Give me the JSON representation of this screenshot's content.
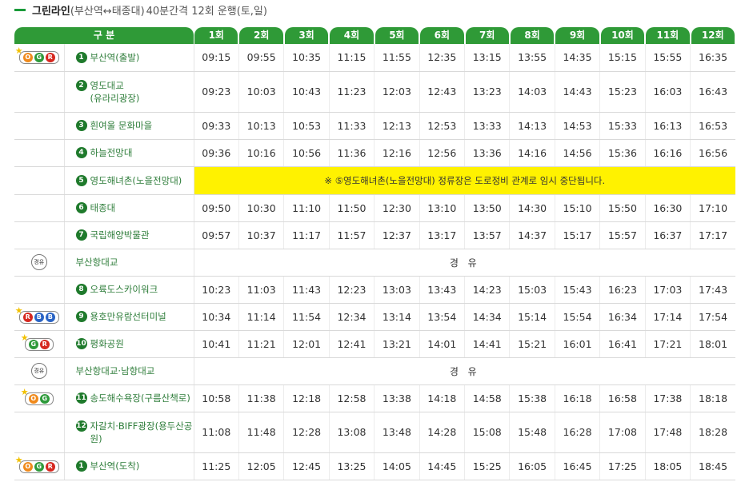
{
  "title": {
    "main": "그린라인",
    "route": "(부산역↔태종대)",
    "detail": "40분간격 12회 운행(토,일)"
  },
  "header": {
    "category": "구 분",
    "runs": [
      "1회",
      "2회",
      "3회",
      "4회",
      "5회",
      "6회",
      "7회",
      "8회",
      "9회",
      "10회",
      "11회",
      "12회"
    ]
  },
  "rows": [
    {
      "num": "1",
      "name": "부산역(출발)",
      "badges": [
        "O",
        "G",
        "R"
      ],
      "star": true,
      "times": [
        "09:15",
        "09:55",
        "10:35",
        "11:15",
        "11:55",
        "12:35",
        "13:15",
        "13:55",
        "14:35",
        "15:15",
        "15:55",
        "16:35"
      ]
    },
    {
      "num": "2",
      "name": "영도대교\n(유라리광장)",
      "badges": [],
      "star": false,
      "times": [
        "09:23",
        "10:03",
        "10:43",
        "11:23",
        "12:03",
        "12:43",
        "13:23",
        "14:03",
        "14:43",
        "15:23",
        "16:03",
        "16:43"
      ]
    },
    {
      "num": "3",
      "name": "흰여울 문화마을",
      "badges": [],
      "star": false,
      "times": [
        "09:33",
        "10:13",
        "10:53",
        "11:33",
        "12:13",
        "12:53",
        "13:33",
        "14:13",
        "14:53",
        "15:33",
        "16:13",
        "16:53"
      ]
    },
    {
      "num": "4",
      "name": "하늘전망대",
      "badges": [],
      "star": false,
      "times": [
        "09:36",
        "10:16",
        "10:56",
        "11:36",
        "12:16",
        "12:56",
        "13:36",
        "14:16",
        "14:56",
        "15:36",
        "16:16",
        "16:56"
      ]
    },
    {
      "num": "5",
      "name": "영도해녀촌(노을전망대)",
      "badges": [],
      "star": false,
      "notice": "※ ⑤영도해녀촌(노을전망대) 정류장은 도로정비 관계로 임시 중단됩니다."
    },
    {
      "num": "6",
      "name": "태종대",
      "badges": [],
      "star": false,
      "times": [
        "09:50",
        "10:30",
        "11:10",
        "11:50",
        "12:30",
        "13:10",
        "13:50",
        "14:30",
        "15:10",
        "15:50",
        "16:30",
        "17:10"
      ]
    },
    {
      "num": "7",
      "name": "국립해양박물관",
      "badges": [],
      "star": false,
      "times": [
        "09:57",
        "10:37",
        "11:17",
        "11:57",
        "12:37",
        "13:17",
        "13:57",
        "14:37",
        "15:17",
        "15:57",
        "16:37",
        "17:17"
      ]
    },
    {
      "num": "",
      "name": "부산항대교",
      "via_badge": "경유",
      "via": "경 유"
    },
    {
      "num": "8",
      "name": "오륙도스카이워크",
      "badges": [],
      "star": false,
      "times": [
        "10:23",
        "11:03",
        "11:43",
        "12:23",
        "13:03",
        "13:43",
        "14:23",
        "15:03",
        "15:43",
        "16:23",
        "17:03",
        "17:43"
      ]
    },
    {
      "num": "9",
      "name": "용호만유람선터미널",
      "badges": [
        "R",
        "B",
        "B"
      ],
      "star": true,
      "times": [
        "10:34",
        "11:14",
        "11:54",
        "12:34",
        "13:14",
        "13:54",
        "14:34",
        "15:14",
        "15:54",
        "16:34",
        "17:14",
        "17:54"
      ]
    },
    {
      "num": "10",
      "name": "평화공원",
      "badges": [
        "G",
        "R"
      ],
      "star": true,
      "times": [
        "10:41",
        "11:21",
        "12:01",
        "12:41",
        "13:21",
        "14:01",
        "14:41",
        "15:21",
        "16:01",
        "16:41",
        "17:21",
        "18:01"
      ]
    },
    {
      "num": "",
      "name": "부산항대교·남항대교",
      "via_badge": "경유",
      "via": "경 유"
    },
    {
      "num": "11",
      "name": "송도해수욕장(구름산책로)",
      "badges": [
        "O",
        "G"
      ],
      "star": true,
      "times": [
        "10:58",
        "11:38",
        "12:18",
        "12:58",
        "13:38",
        "14:18",
        "14:58",
        "15:38",
        "16:18",
        "16:58",
        "17:38",
        "18:18"
      ]
    },
    {
      "num": "12",
      "name": "자갈치·BIFF광장(용두산공\n원)",
      "badges": [],
      "star": false,
      "times": [
        "11:08",
        "11:48",
        "12:28",
        "13:08",
        "13:48",
        "14:28",
        "15:08",
        "15:48",
        "16:28",
        "17:08",
        "17:48",
        "18:28"
      ]
    },
    {
      "num": "1",
      "name": "부산역(도착)",
      "badges": [
        "O",
        "G",
        "R"
      ],
      "star": true,
      "times": [
        "11:25",
        "12:05",
        "12:45",
        "13:25",
        "14:05",
        "14:45",
        "15:25",
        "16:05",
        "16:45",
        "17:25",
        "18:05",
        "18:45"
      ]
    }
  ],
  "colors": {
    "header_green": "#2f9a37",
    "notice_yellow": "#fff200",
    "stop_text": "#2e7d3a"
  }
}
